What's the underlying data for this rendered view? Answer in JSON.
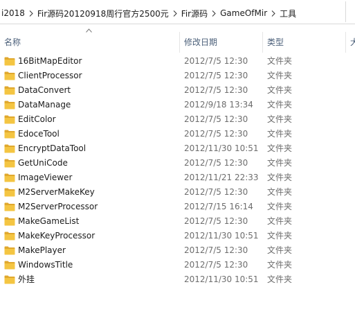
{
  "breadcrumb": {
    "items": [
      "i2018",
      "Fir源码20120918周行官方2500元",
      "Fir源码",
      "GameOfMir",
      "工具"
    ]
  },
  "columns": {
    "name": "名称",
    "date": "修改日期",
    "type": "类型",
    "size": "大"
  },
  "colors": {
    "folder": "#f4c542",
    "folder_dark": "#e0a82e",
    "header_text": "#4c607a",
    "meta_text": "#6d6d6d"
  },
  "files": [
    {
      "name": "16BitMapEditor",
      "date": "2012/7/5 12:30",
      "type": "文件夹",
      "icon": "folder-icon"
    },
    {
      "name": "ClientProcessor",
      "date": "2012/7/5 12:30",
      "type": "文件夹",
      "icon": "folder-icon"
    },
    {
      "name": "DataConvert",
      "date": "2012/7/5 12:30",
      "type": "文件夹",
      "icon": "folder-icon"
    },
    {
      "name": "DataManage",
      "date": "2012/9/18 13:34",
      "type": "文件夹",
      "icon": "folder-icon"
    },
    {
      "name": "EditColor",
      "date": "2012/7/5 12:30",
      "type": "文件夹",
      "icon": "folder-icon"
    },
    {
      "name": "EdoceTool",
      "date": "2012/7/5 12:30",
      "type": "文件夹",
      "icon": "folder-icon"
    },
    {
      "name": "EncryptDataTool",
      "date": "2012/11/30 10:51",
      "type": "文件夹",
      "icon": "folder-icon"
    },
    {
      "name": "GetUniCode",
      "date": "2012/7/5 12:30",
      "type": "文件夹",
      "icon": "folder-icon"
    },
    {
      "name": "ImageViewer",
      "date": "2012/11/21 22:33",
      "type": "文件夹",
      "icon": "folder-icon"
    },
    {
      "name": "M2ServerMakeKey",
      "date": "2012/7/5 12:30",
      "type": "文件夹",
      "icon": "folder-icon"
    },
    {
      "name": "M2ServerProcessor",
      "date": "2012/7/15 16:14",
      "type": "文件夹",
      "icon": "folder-icon"
    },
    {
      "name": "MakeGameList",
      "date": "2012/7/5 12:30",
      "type": "文件夹",
      "icon": "folder-icon"
    },
    {
      "name": "MakeKeyProcessor",
      "date": "2012/11/30 10:51",
      "type": "文件夹",
      "icon": "folder-icon"
    },
    {
      "name": "MakePlayer",
      "date": "2012/7/5 12:30",
      "type": "文件夹",
      "icon": "folder-icon"
    },
    {
      "name": "WindowsTitle",
      "date": "2012/7/5 12:30",
      "type": "文件夹",
      "icon": "folder-icon"
    },
    {
      "name": "外挂",
      "date": "2012/11/30 10:51",
      "type": "文件夹",
      "icon": "folder-icon"
    }
  ]
}
